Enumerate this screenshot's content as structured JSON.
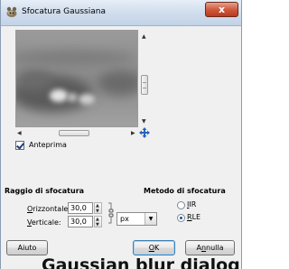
{
  "window": {
    "title": "Sfocatura Gaussiana",
    "close_label": "x"
  },
  "preview": {
    "checkbox_label": "Anteprima",
    "checked": true
  },
  "blur_radius": {
    "title": "Raggio di sfocatura",
    "horizontal": {
      "label_underline": "O",
      "label_rest": "rizzontale:",
      "value": "30,0"
    },
    "vertical": {
      "label_underline": "V",
      "label_rest": "erticale:",
      "value": "30,0"
    },
    "unit": "px"
  },
  "blur_method": {
    "title": "Metodo di sfocatura",
    "options": [
      {
        "underline": "I",
        "rest": "IR",
        "selected": false
      },
      {
        "underline": "R",
        "rest": "LE",
        "selected": true
      }
    ]
  },
  "buttons": {
    "help": "Aiuto",
    "ok_underline": "O",
    "ok_rest": "K",
    "cancel_pre": "A",
    "cancel_underline": "n",
    "cancel_rest": "nulla"
  },
  "overlay_text": "Gaussian blur dialog"
}
